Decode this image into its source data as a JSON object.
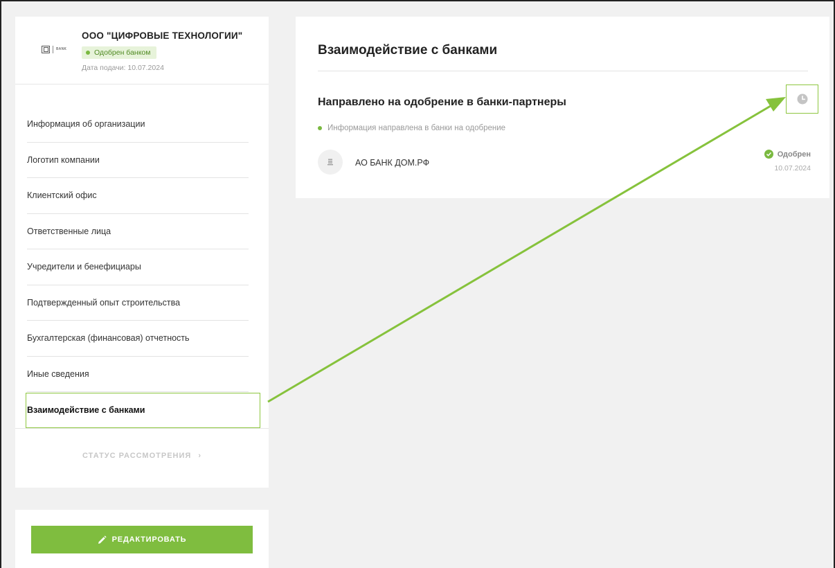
{
  "organization": {
    "name": "ООО \"ЦИФРОВЫЕ ТЕХНОЛОГИИ\"",
    "logo_text": "BANK",
    "status": "Одобрен банком",
    "submit_date": "Дата подачи: 10.07.2024"
  },
  "sidebar": {
    "items": [
      {
        "label": "Информация об организации"
      },
      {
        "label": "Логотип компании"
      },
      {
        "label": "Клиентский офис"
      },
      {
        "label": "Ответственные лица"
      },
      {
        "label": "Учредители и бенефициары"
      },
      {
        "label": "Подтвержденный опыт строительства"
      },
      {
        "label": "Бухгалтерская (финансовая) отчетность"
      },
      {
        "label": "Иные сведения"
      },
      {
        "label": "Взаимодействие с банками"
      }
    ],
    "active_index": 8,
    "review_status_label": "СТАТУС РАССМОТРЕНИЯ",
    "review_status_icon": "chevron-right-icon"
  },
  "actions": {
    "edit_label": "РЕДАКТИРОВАТЬ",
    "edit_icon": "pencil-icon"
  },
  "main": {
    "title": "Взаимодействие с банками",
    "section_title": "Направлено на одобрение в банки-партнеры",
    "history_icon": "clock-icon",
    "info_text": "Информация направлена в банки на одобрение",
    "banks": [
      {
        "name": "АО БАНК ДОМ.РФ",
        "status": "Одобрен",
        "date": "10.07.2024"
      }
    ]
  },
  "colors": {
    "accent": "#7fbd3f",
    "highlight": "#8dc63f",
    "background": "#f1f1f1"
  }
}
